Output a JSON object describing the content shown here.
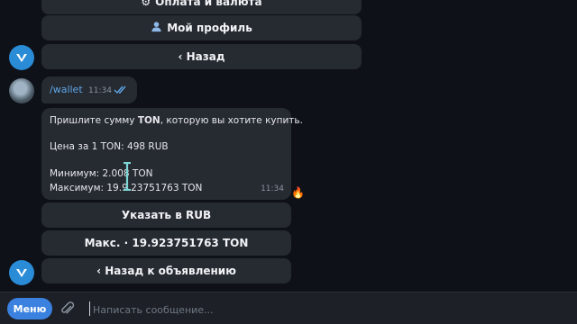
{
  "keyboard_top": {
    "payment_label": "Оплата и валюта",
    "profile_label": "Мой профиль",
    "back_label": "‹ Назад"
  },
  "outgoing": {
    "text": "/wallet",
    "time": "11:34"
  },
  "incoming": {
    "line1_pre": "Пришлите сумму ",
    "line1_bold": "TON",
    "line1_post": ", которую вы хотите купить.",
    "price": "Цена за 1 TON: 498 RUB",
    "minimum": "Минимум: 2.008   TON",
    "maximum": "Максимум: 19.9 23751763 TON",
    "time": "11:34",
    "reaction": "🔥"
  },
  "keyboard_bottom": {
    "specify_rub": "Указать в RUB",
    "max": "Макс. · 19.923751763 TON",
    "back_to_ad": "‹ Назад к объявлению"
  },
  "composer": {
    "menu_label": "Меню",
    "placeholder": "Написать сообщение..."
  },
  "colors": {
    "accent": "#3b82e0",
    "bot_avatar": "#2a8bd6",
    "link": "#5fa8e8"
  }
}
